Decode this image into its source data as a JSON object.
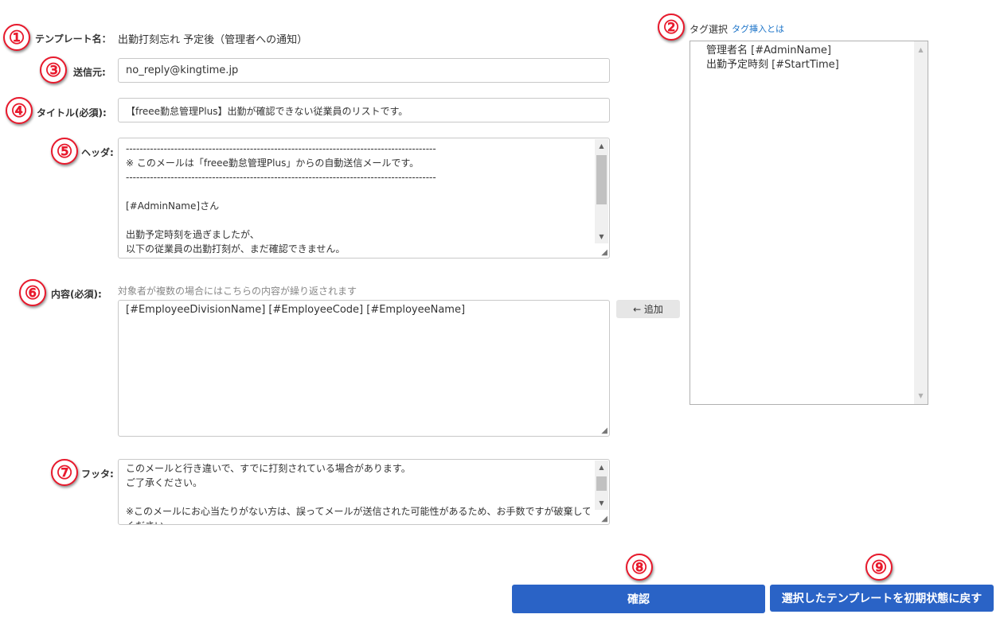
{
  "callouts": [
    "①",
    "②",
    "③",
    "④",
    "⑤",
    "⑥",
    "⑦",
    "⑧",
    "⑨"
  ],
  "template_name": {
    "label": "テンプレート名：",
    "value": "出勤打刻忘れ 予定後（管理者への通知）"
  },
  "sender": {
    "label": "送信元:",
    "value": "no_reply@kingtime.jp"
  },
  "title": {
    "label": "タイトル(必須):",
    "value": "【freee勤怠管理Plus】出勤が確認できない従業員のリストです。"
  },
  "header": {
    "label": "ヘッダ:",
    "lines": [
      "------------------------------------------------------------------------------------------",
      "※ このメールは「freee勤怠管理Plus」からの自動送信メールです。",
      "------------------------------------------------------------------------------------------",
      "",
      "[#AdminName]さん",
      "",
      "出勤予定時刻を過ぎましたが、",
      "以下の従業員の出勤打刻が、まだ確認できません。"
    ]
  },
  "content": {
    "label": "内容(必須):",
    "note": "対象者が複数の場合にはこちらの内容が繰り返されます",
    "value": "[#EmployeeDivisionName]  [#EmployeeCode]  [#EmployeeName]"
  },
  "add_button": "← 追加",
  "footer": {
    "label": "フッタ:",
    "lines": [
      "このメールと行き違いで、すでに打刻されている場合があります。",
      "ご了承ください。",
      "",
      "※このメールにお心当たりがない方は、誤ってメールが送信された可能性があるため、お手数ですが破棄して",
      "ください。"
    ]
  },
  "tag_select": {
    "label": "タグ選択",
    "help_link": "タグ挿入とは",
    "items": [
      "管理者名 [#AdminName]",
      "出勤予定時刻 [#StartTime]"
    ]
  },
  "buttons": {
    "confirm": "確認",
    "reset": "選択したテンプレートを初期状態に戻す"
  },
  "colors": {
    "accent": "#2a63c6",
    "callout": "#e8192c",
    "link": "#1a73c8"
  },
  "icons": {
    "scroll_up": "▲",
    "scroll_down": "▼",
    "resize_grip": "◢"
  }
}
